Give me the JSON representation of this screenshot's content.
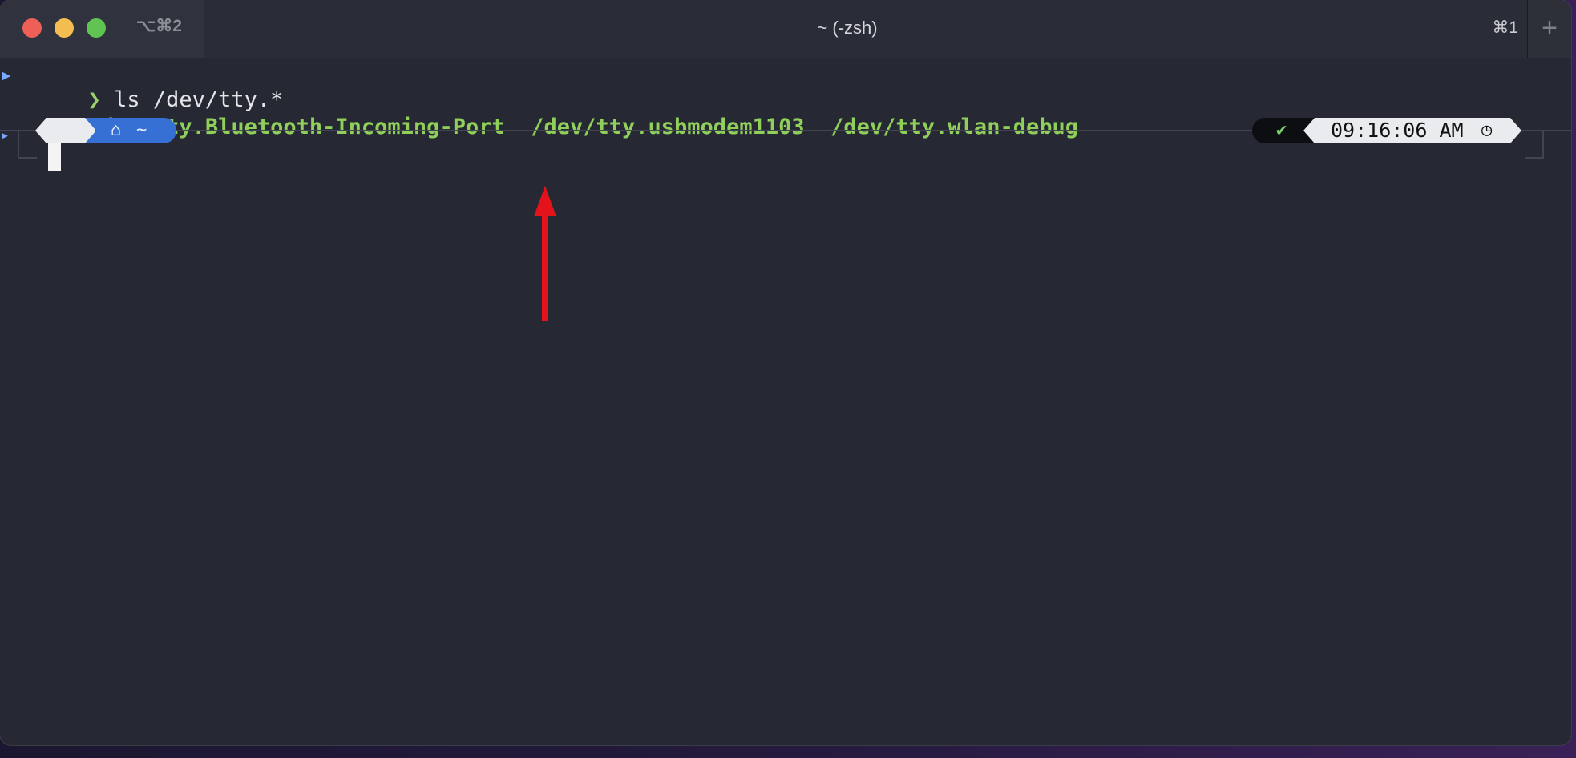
{
  "titlebar": {
    "tab_shortcut": "⌥⌘2",
    "window_title": "~ (-zsh)",
    "right_shortcut": "⌘1",
    "new_tab": "+"
  },
  "terminal": {
    "prompt_char": "❯",
    "command": "ls /dev/tty.*",
    "outputs": [
      "/dev/tty.Bluetooth-Incoming-Port",
      "/dev/tty.usbmodem1103",
      "/dev/tty.wlan-debug"
    ]
  },
  "powerline": {
    "os_icon": "",
    "home_icon": "⌂",
    "path": "~",
    "status_icon": "✔",
    "time": "09:16:06 AM",
    "clock_icon": "◷"
  },
  "colors": {
    "output_green": "#8fcf5a",
    "annotation_red": "#e3131b",
    "path_blue": "#3670d4"
  }
}
